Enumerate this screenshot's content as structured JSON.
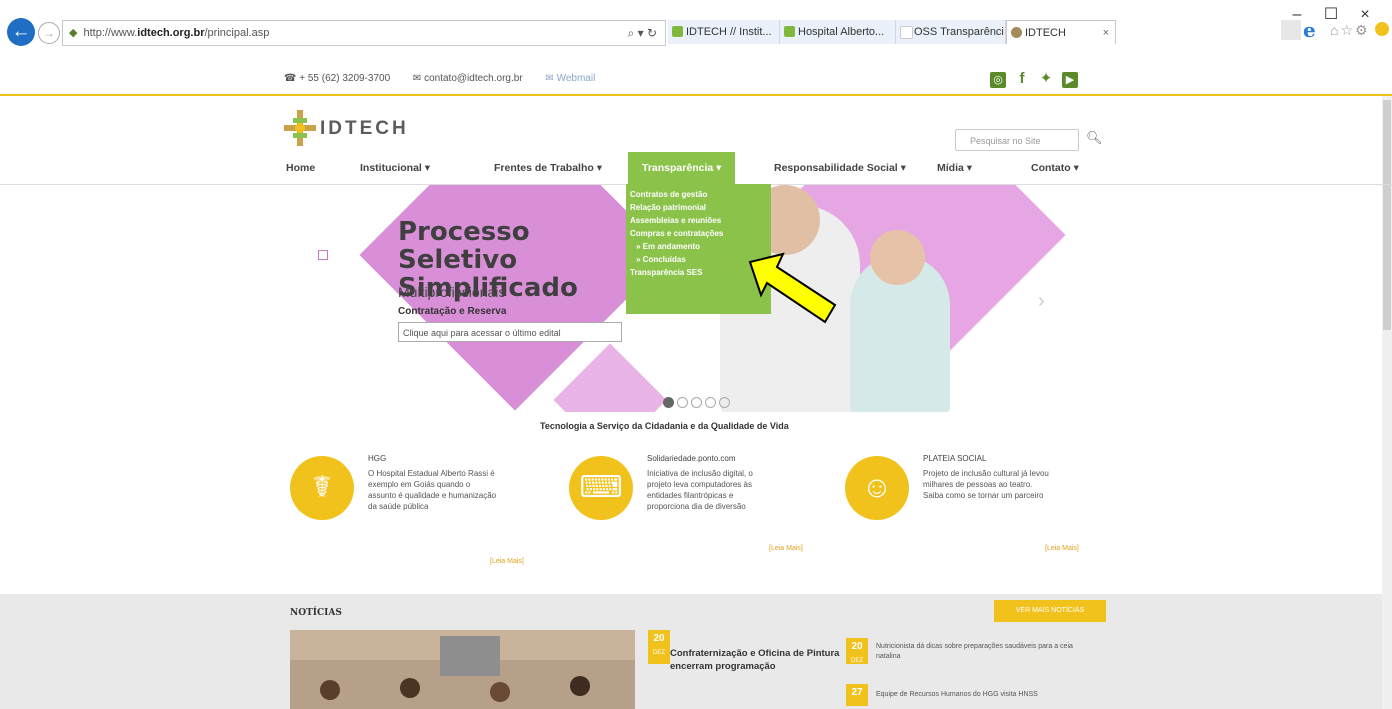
{
  "browser": {
    "url_prefix": "http://www.",
    "url_host": "idtech.org.br",
    "url_path": "/principal.asp",
    "tabs": [
      "IDTECH // Instit...",
      "Hospital Alberto...",
      "OSS Transparênci...",
      "IDTECH"
    ],
    "window_controls": [
      "–",
      "☐",
      "×"
    ]
  },
  "topbar": {
    "phone": "+ 55 (62) 3209-3700",
    "email": "contato@idtech.org.br",
    "webmail": "Webmail"
  },
  "logo": {
    "text": "IDTECH"
  },
  "search": {
    "placeholder": "Pesquisar no Site"
  },
  "nav": [
    {
      "label": "Home"
    },
    {
      "label": "Institucional ▾"
    },
    {
      "label": "Frentes de Trabalho ▾"
    },
    {
      "label": "Transparência ▾"
    },
    {
      "label": "Responsabilidade Social ▾"
    },
    {
      "label": "Mídia ▾"
    },
    {
      "label": "Contato ▾"
    }
  ],
  "dropdown": [
    "Contratos de gestão",
    "Relação patrimonial",
    "Assembleias e reuniões",
    "Compras e contratações",
    "»  Em andamento",
    "»  Concluídas",
    "Transparência SES"
  ],
  "hero": {
    "title": "Processo Seletivo Simplificado",
    "subtitle": "Multiprofissionais",
    "note": "Contratação e Reserva",
    "link": "Clique aqui para acessar o último edital"
  },
  "tagline": "Tecnologia a Serviço da Cidadania e da Qualidade de Vida",
  "features": [
    {
      "title": "HGG",
      "desc": "O Hospital Estadual Alberto Rassi é exemplo em Goiás quando o assunto é qualidade e humanização da saúde pública",
      "more": "[Leia Mais]",
      "icon": "stethoscope-icon"
    },
    {
      "title": "Solidariedade.ponto.com",
      "desc": "Iniciativa de inclusão digital, o projeto leva computadores às entidades filantrópicas e proporciona dia de diversão",
      "more": "[Leia Mais]",
      "icon": "computer-user-icon"
    },
    {
      "title": "PLATEIA SOCIAL",
      "desc": "Projeto de inclusão cultural já levou milhares de pessoas ao teatro. Saiba como se tornar um parceiro",
      "more": "[Leia Mais]",
      "icon": "theater-masks-icon"
    }
  ],
  "news": {
    "title": "NOTÍCIAS",
    "all_button": "VER MAIS NOTÍCIAS",
    "main_date_day": "20",
    "main_date_month": "DEZ",
    "main_headline": "Confraternização e Oficina de Pintura encerram programação",
    "side": [
      {
        "day": "20",
        "month": "DEZ",
        "text": "Nutricionista dá dicas sobre preparações saudáveis para a ceia natalina"
      },
      {
        "day": "27",
        "month": "",
        "text": "Equipe de Recursos Humanos do HGG visita HNSS"
      }
    ]
  },
  "colors": {
    "accent_green": "#8bc34a",
    "accent_yellow": "#f2c21c",
    "hero_pink": "#d98fd7"
  }
}
